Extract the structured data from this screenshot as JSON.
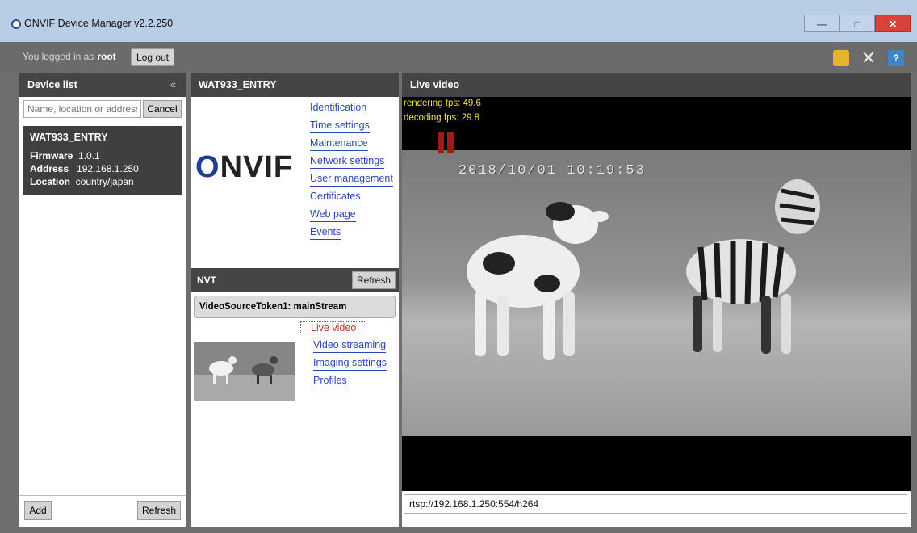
{
  "window": {
    "title": "ONVIF Device Manager v2.2.250",
    "minimize": "—",
    "maximize": "□",
    "close": "✕"
  },
  "login": {
    "prefix": "You logged in as",
    "user": "root",
    "logout_label": "Log out"
  },
  "toolbar": {
    "icons": [
      "plugin-icon",
      "tools-icon",
      "help-icon"
    ],
    "help_glyph": "?",
    "tools_glyph": "✕"
  },
  "device_list": {
    "title": "Device list",
    "collapse_glyph": "«",
    "search": {
      "placeholder": "Name, location or address",
      "value": ""
    },
    "cancel_label": "Cancel",
    "device": {
      "name": "WAT933_ENTRY",
      "firmware_label": "Firmware",
      "firmware": "1.0.1",
      "address_label": "Address",
      "address": "192.168.1.250",
      "location_label": "Location",
      "location": "country/japan"
    },
    "add_label": "Add",
    "refresh_label": "Refresh"
  },
  "device_panel": {
    "title": "WAT933_ENTRY",
    "logo": "ONVIF",
    "links": [
      "Identification",
      "Time settings",
      "Maintenance",
      "Network settings",
      "User management",
      "Certificates",
      "Web page",
      "Events"
    ],
    "nvt_title": "NVT",
    "nvt_refresh": "Refresh",
    "stream": "VideoSourceToken1: mainStream",
    "stream_links": [
      "Live video",
      "Video streaming",
      "Imaging settings",
      "Profiles"
    ]
  },
  "live_video": {
    "title": "Live video",
    "rendering_fps": "rendering fps: 49.6",
    "decoding_fps": "decoding fps: 29.8",
    "timestamp": "2018/10/01 10:19:53",
    "url": "rtsp://192.168.1.250:554/h264"
  }
}
